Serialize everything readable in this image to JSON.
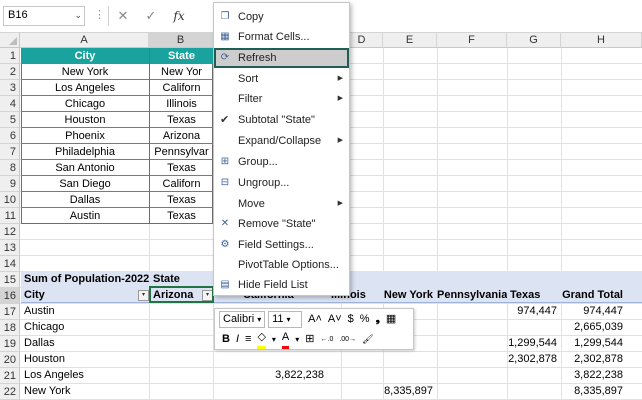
{
  "formula_bar": {
    "name_box": "B16",
    "dropdown_glyph": "⌄",
    "grip": "⋮",
    "cancel_glyph": "✕",
    "enter_glyph": "✓",
    "fx_label": "fx"
  },
  "column_headers": [
    "A",
    "B",
    "C",
    "D",
    "E",
    "F",
    "G",
    "H"
  ],
  "row_headers": [
    "1",
    "2",
    "3",
    "4",
    "5",
    "6",
    "7",
    "8",
    "9",
    "10",
    "11",
    "12",
    "13",
    "14",
    "15",
    "16",
    "17",
    "18",
    "19",
    "20",
    "21",
    "22"
  ],
  "source_table": {
    "headers": [
      "City",
      "State"
    ],
    "rows": [
      [
        "New York",
        "New Yor"
      ],
      [
        "Los Angeles",
        "Californ"
      ],
      [
        "Chicago",
        "Illinois"
      ],
      [
        "Houston",
        "Texas"
      ],
      [
        "Phoenix",
        "Arizona"
      ],
      [
        "Philadelphia",
        "Pennsylvar"
      ],
      [
        "San Antonio",
        "Texas"
      ],
      [
        "San Diego",
        "Californ"
      ],
      [
        "Dallas",
        "Texas"
      ],
      [
        "Austin",
        "Texas"
      ]
    ]
  },
  "pivot": {
    "title": "Sum of Population-2022",
    "col_field": "State",
    "row_field": "City",
    "filter_glyph": "▾",
    "col_headers": [
      "Arizona",
      "California",
      "Illinois",
      "New York",
      "Pennsylvania",
      "Texas",
      "Grand Total"
    ],
    "rows": [
      {
        "city": "Austin",
        "california": "",
        "new_york": "",
        "texas": "974,447",
        "total": "974,447"
      },
      {
        "city": "Chicago",
        "california": "",
        "new_york": "",
        "texas": "",
        "total": "2,665,039"
      },
      {
        "city": "Dallas",
        "california": "",
        "new_york": "",
        "texas": "1,299,544",
        "total": "1,299,544"
      },
      {
        "city": "Houston",
        "california": "",
        "new_york": "",
        "texas": "2,302,878",
        "total": "2,302,878"
      },
      {
        "city": "Los Angeles",
        "california": "3,822,238",
        "new_york": "",
        "texas": "",
        "total": "3,822,238"
      },
      {
        "city": "New York",
        "california": "",
        "new_york": "8,335,897",
        "texas": "",
        "total": "8,335,897"
      }
    ]
  },
  "context_menu": {
    "items": [
      {
        "label": "Copy",
        "icon": "copy-icon",
        "glyph": "❐"
      },
      {
        "label": "Format Cells...",
        "icon": "format-cells-icon",
        "glyph": "▦"
      },
      {
        "label": "Refresh",
        "icon": "refresh-icon",
        "glyph": "⟳"
      },
      {
        "label": "Sort",
        "icon": "",
        "glyph": "",
        "arrow": "▶"
      },
      {
        "label": "Filter",
        "icon": "",
        "glyph": "",
        "arrow": "▶"
      },
      {
        "label": "Subtotal \"State\"",
        "icon": "checkmark-icon",
        "glyph": "✔"
      },
      {
        "label": "Expand/Collapse",
        "icon": "",
        "glyph": "",
        "arrow": "▶"
      },
      {
        "label": "Group...",
        "icon": "group-icon",
        "glyph": "⊞"
      },
      {
        "label": "Ungroup...",
        "icon": "ungroup-icon",
        "glyph": "⊟"
      },
      {
        "label": "Move",
        "icon": "",
        "glyph": "",
        "arrow": "▶"
      },
      {
        "label": "Remove \"State\"",
        "icon": "remove-icon",
        "glyph": "✕"
      },
      {
        "label": "Field Settings...",
        "icon": "field-settings-icon",
        "glyph": "⚙"
      },
      {
        "label": "PivotTable Options...",
        "icon": "",
        "glyph": ""
      },
      {
        "label": "Hide Field List",
        "icon": "field-list-icon",
        "glyph": "▤"
      }
    ],
    "highlighted": "Refresh"
  },
  "mini_toolbar": {
    "font": "Calibri",
    "size": "11",
    "dropdown_glyph": "▾",
    "grow_font": "A˄",
    "shrink_font": "A˅",
    "currency": "$",
    "percent": "%",
    "comma": "❟",
    "bold": "B",
    "italic": "I",
    "align": "≡",
    "fill_color": "◇",
    "font_color": "A",
    "borders": "⊞",
    "increase_decimal": "←.0",
    "decrease_decimal": ".00→",
    "format_painter": "🖌",
    "table_glyph": "▦",
    "fill_color_hex": "#ffff00",
    "font_color_hex": "#ff0000"
  },
  "colors": {
    "table_header": "#1aa39e",
    "pivot_header": "#dce3f3",
    "selection": "#217346",
    "menu_highlight_border": "#1f5e56"
  }
}
